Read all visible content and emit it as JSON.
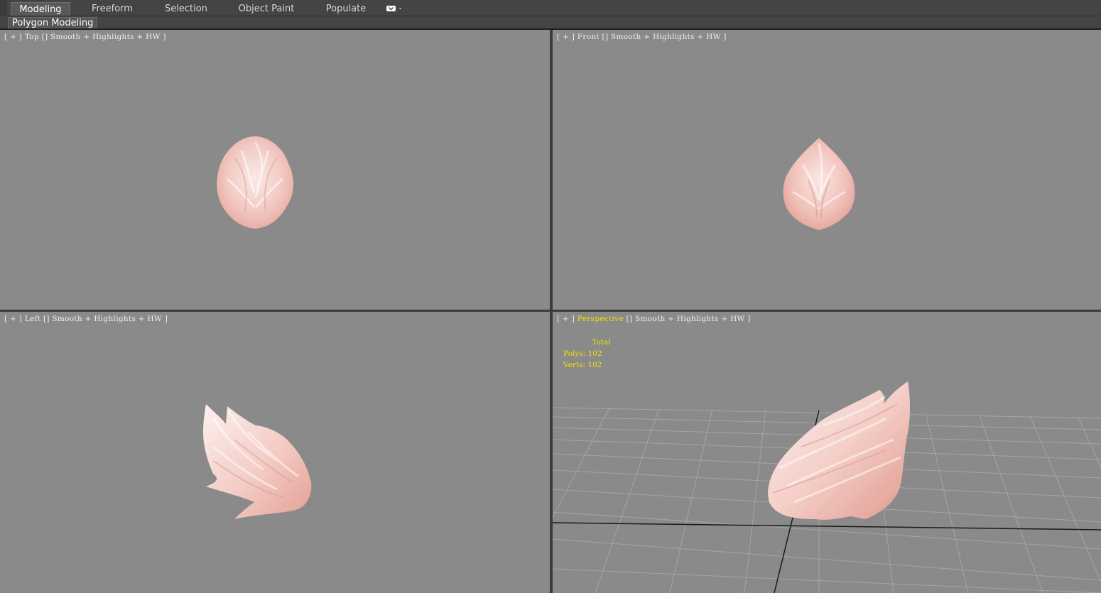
{
  "ribbon": {
    "tabs": [
      {
        "label": "Modeling",
        "active": true
      },
      {
        "label": "Freeform",
        "active": false
      },
      {
        "label": "Selection",
        "active": false
      },
      {
        "label": "Object Paint",
        "active": false
      },
      {
        "label": "Populate",
        "active": false
      }
    ],
    "overflow_icon": "options-dropdown-icon",
    "panel_label": "Polygon Modeling"
  },
  "viewports": {
    "top": {
      "open": "[ + ]",
      "name": "Top",
      "shading": "Smooth + Highlights + HW",
      "close": "]"
    },
    "front": {
      "open": "[ + ]",
      "name": "Front",
      "shading": "Smooth + Highlights + HW",
      "close": "]"
    },
    "left": {
      "open": "[ + ]",
      "name": "Left",
      "shading": "Smooth + Highlights + HW",
      "close": "]"
    },
    "perspective": {
      "open": "[ + ]",
      "name": "Perspective",
      "shading": "Smooth + Highlights + HW",
      "close": "]"
    }
  },
  "stats": {
    "header": "Total",
    "polys_label": "Polys:",
    "polys_value": "102",
    "verts_label": "Verts:",
    "verts_value": "102"
  },
  "colors": {
    "viewport_bg": "#8a8a8a",
    "active_label": "#f2e000",
    "mesh_light": "#fbe9e6",
    "mesh_dark": "#e6a89e"
  }
}
